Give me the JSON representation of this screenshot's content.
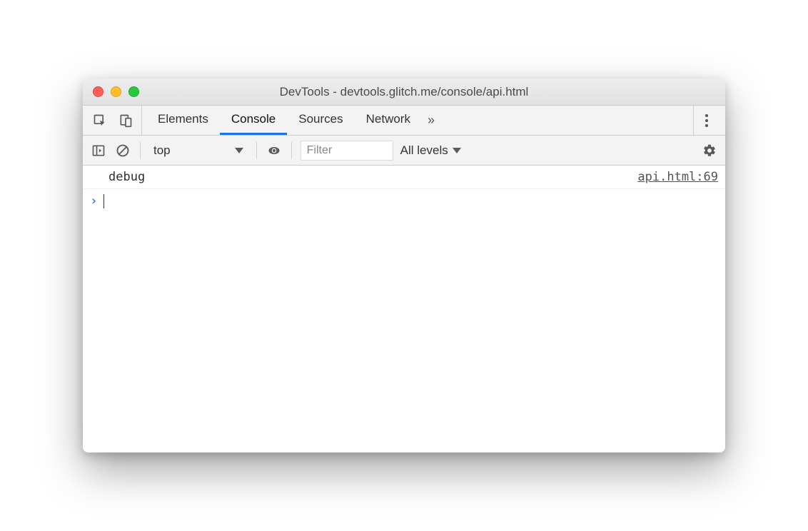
{
  "window": {
    "title": "DevTools - devtools.glitch.me/console/api.html"
  },
  "tabs": {
    "items": [
      "Elements",
      "Console",
      "Sources",
      "Network"
    ],
    "active_index": 1
  },
  "toolbar": {
    "context": "top",
    "filter_placeholder": "Filter",
    "levels_label": "All levels"
  },
  "console": {
    "logs": [
      {
        "message": "debug",
        "source": "api.html:69"
      }
    ]
  }
}
